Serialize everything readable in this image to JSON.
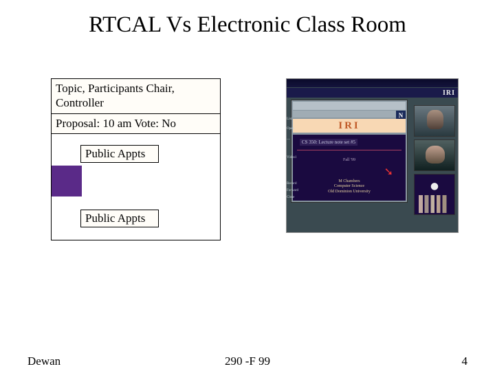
{
  "title": "RTCAL Vs   Electronic Class Room",
  "left": {
    "topic_line": "Topic, Participants Chair, Controller",
    "proposal_line": "Proposal: 10 am        Vote: No",
    "appt1": "Public Appts",
    "appt2": "Public Appts"
  },
  "screenshot": {
    "banner_brand": "IRI",
    "nav_badge": "N",
    "app_title": "IRI",
    "slide_title": "CS 350: Lecture note set #5",
    "slide_mid": "Fall '99",
    "slide_footer_1": "M Chambers",
    "slide_footer_2": "Computer Science",
    "slide_footer_3": "Old Dominion University",
    "side_labels": [
      "List",
      "Open",
      "—",
      "Video1",
      "Record",
      "Forward",
      "Close"
    ]
  },
  "footer": {
    "author": "Dewan",
    "course": "290 -F 99",
    "page": "4"
  }
}
